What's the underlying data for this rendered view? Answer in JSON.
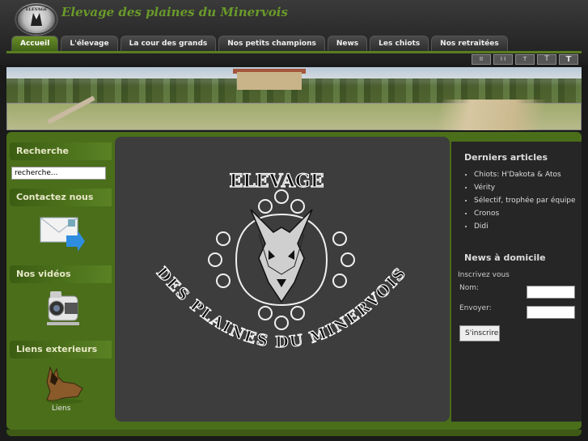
{
  "header": {
    "site_title": "Elevage des plaines du Minervois",
    "logo_label": "ELEVAGE DES PLAINES DU MINERVOIS"
  },
  "nav": {
    "tabs": [
      "Accueil",
      "L'élevage",
      "La cour des grands",
      "Nos petits champions",
      "News",
      "Les chiots",
      "Nos retraitées"
    ],
    "active": "Accueil"
  },
  "font_sizer": [
    "II",
    "I I",
    "T",
    "T",
    "T"
  ],
  "sidebar": {
    "search_heading": "Recherche",
    "search_value": "recherche...",
    "contact_heading": "Contactez nous",
    "videos_heading": "Nos vidéos",
    "links_heading": "Liens exterieurs",
    "links_caption": "Liens"
  },
  "main": {
    "emblem_top": "ELEVAGE",
    "emblem_bottom": "DES PLAINES DU MINERVOIS"
  },
  "right": {
    "articles_heading": "Derniers articles",
    "articles": [
      "Chiots: H'Dakota & Atos",
      "Vérity",
      "Sélectif, trophée par équipe",
      "Cronos",
      "Didi"
    ],
    "news_heading": "News à domicile",
    "subscribe_label": "Inscrivez vous",
    "name_label": "Nom:",
    "send_label": "Envoyer:",
    "subscribe_button": "S'inscrire"
  },
  "colors": {
    "accent_green": "#6a9a2a",
    "content_green": "#4a6e1a",
    "dark_panel": "#3d3d3d"
  }
}
